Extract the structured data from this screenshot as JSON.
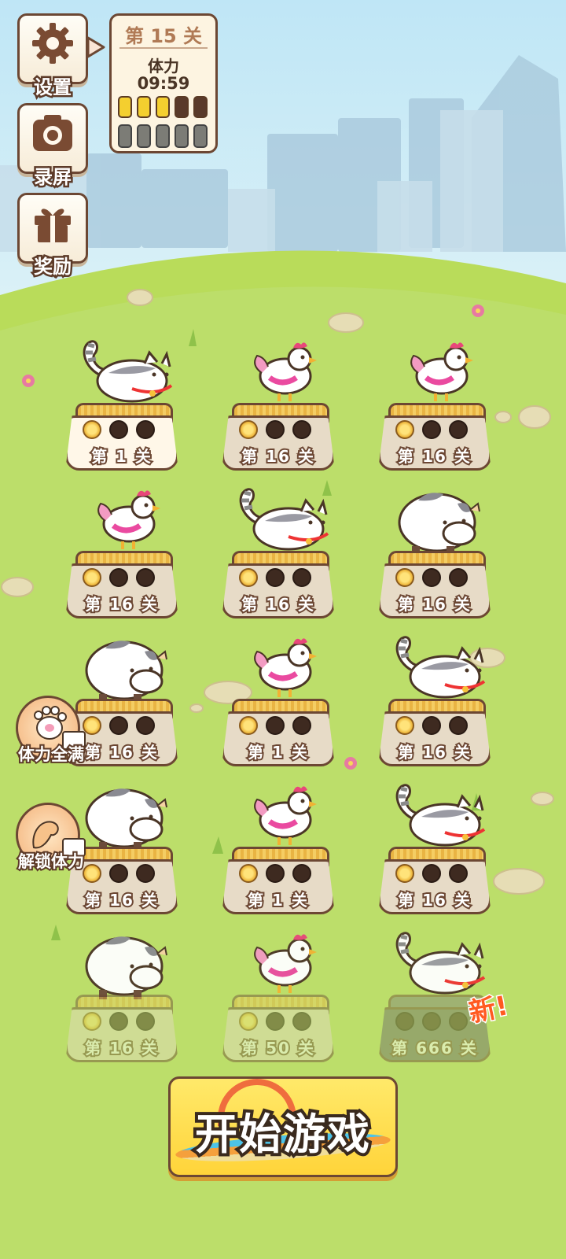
{
  "sidebar": {
    "settings": {
      "label": "设置",
      "icon": "gear-icon"
    },
    "record": {
      "label": "录屏",
      "icon": "camera-icon"
    },
    "reward": {
      "label": "奖励",
      "icon": "gift-icon"
    }
  },
  "status": {
    "level": "第 15 关",
    "stamina_label": "体力",
    "timer": "09:59",
    "stamina_filled": 3,
    "stamina_total": 5
  },
  "levels": [
    {
      "label": "第 1 关",
      "coins": 1,
      "animal": "cat",
      "active": true
    },
    {
      "label": "第 16 关",
      "coins": 1,
      "animal": "chicken"
    },
    {
      "label": "第 16 关",
      "coins": 1,
      "animal": "chicken"
    },
    {
      "label": "第 16 关",
      "coins": 1,
      "animal": "chicken"
    },
    {
      "label": "第 16 关",
      "coins": 1,
      "animal": "cat"
    },
    {
      "label": "第 16 关",
      "coins": 1,
      "animal": "cow"
    },
    {
      "label": "第 16 关",
      "coins": 1,
      "animal": "cow"
    },
    {
      "label": "第 1 关",
      "coins": 1,
      "animal": "chicken"
    },
    {
      "label": "第 16 关",
      "coins": 1,
      "animal": "cat"
    },
    {
      "label": "第 16 关",
      "coins": 1,
      "animal": "cow"
    },
    {
      "label": "第 1 关",
      "coins": 1,
      "animal": "chicken"
    },
    {
      "label": "第 16 关",
      "coins": 1,
      "animal": "cat"
    },
    {
      "label": "第 16 关",
      "coins": 1,
      "animal": "cow",
      "faded": true
    },
    {
      "label": "第 50 关",
      "coins": 1,
      "animal": "chicken",
      "faded": true
    },
    {
      "label": "第 666 关",
      "coins": 0,
      "animal": "cat",
      "faded": true,
      "locked": true
    }
  ],
  "boosts": {
    "full_stamina": "体力全满",
    "unlock_stamina": "解锁体力"
  },
  "new_tag": "新!",
  "start_button": "开始游戏",
  "colors": {
    "outline": "#6c4733",
    "grass": "#b9dc5a",
    "sky": "#bfe6f6",
    "button": "#ffd43a"
  }
}
